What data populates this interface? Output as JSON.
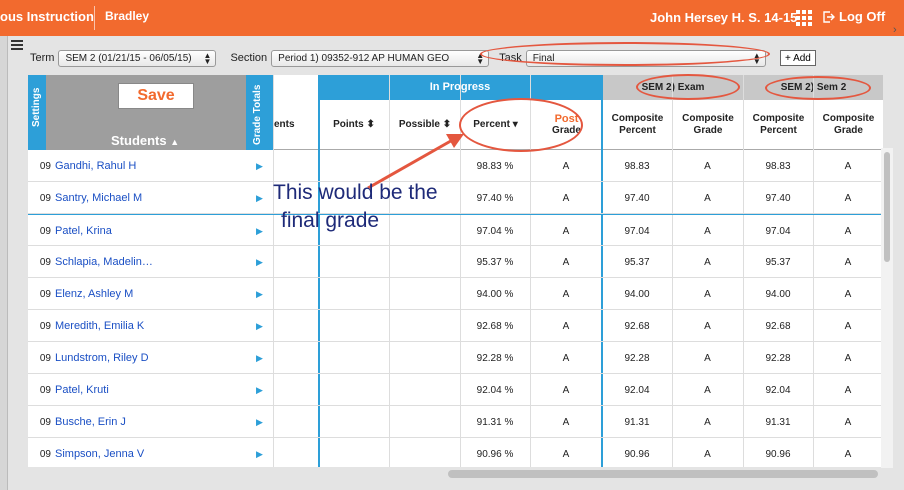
{
  "topbar": {
    "app_title": "ous Instruction",
    "user": "Bradley",
    "school": "John Hersey H. S. 14-15",
    "logoff": "Log Off"
  },
  "filters": {
    "term_label": "Term",
    "term_value": "SEM 2 (01/21/15 - 06/05/15)",
    "section_label": "Section",
    "section_value": "Period 1) 09352-912 AP HUMAN GEO",
    "task_label": "Task",
    "task_value": "Final",
    "add_label": "+ Add"
  },
  "grid": {
    "settings_label": "Settings",
    "save_label": "Save",
    "students_label": "Students",
    "grade_totals_label": "Grade Totals",
    "in_progress_label": "In Progress",
    "exam_label": "SEM 2) Exam",
    "sem2_label": "SEM 2) Sem 2",
    "columns": {
      "ents": "ents",
      "points": "Points",
      "possible": "Possible",
      "percent": "Percent",
      "post": "Post",
      "grade": "Grade",
      "composite_percent": "Composite Percent",
      "composite_grade": "Composite Grade"
    },
    "rows": [
      {
        "grade": "09",
        "name": "Gandhi, Rahul H",
        "percent": "98.83 %",
        "post_grade": "A",
        "exam_pct": "98.83",
        "exam_grade": "A",
        "sem_pct": "98.83",
        "sem_grade": "A"
      },
      {
        "grade": "09",
        "name": "Santry, Michael M",
        "percent": "97.40 %",
        "post_grade": "A",
        "exam_pct": "97.40",
        "exam_grade": "A",
        "sem_pct": "97.40",
        "sem_grade": "A"
      },
      {
        "grade": "09",
        "name": "Patel, Krina",
        "percent": "97.04 %",
        "post_grade": "A",
        "exam_pct": "97.04",
        "exam_grade": "A",
        "sem_pct": "97.04",
        "sem_grade": "A"
      },
      {
        "grade": "09",
        "name": "Schlapia, Madelin…",
        "percent": "95.37 %",
        "post_grade": "A",
        "exam_pct": "95.37",
        "exam_grade": "A",
        "sem_pct": "95.37",
        "sem_grade": "A"
      },
      {
        "grade": "09",
        "name": "Elenz, Ashley M",
        "percent": "94.00 %",
        "post_grade": "A",
        "exam_pct": "94.00",
        "exam_grade": "A",
        "sem_pct": "94.00",
        "sem_grade": "A"
      },
      {
        "grade": "09",
        "name": "Meredith, Emilia K",
        "percent": "92.68 %",
        "post_grade": "A",
        "exam_pct": "92.68",
        "exam_grade": "A",
        "sem_pct": "92.68",
        "sem_grade": "A"
      },
      {
        "grade": "09",
        "name": "Lundstrom, Riley D",
        "percent": "92.28 %",
        "post_grade": "A",
        "exam_pct": "92.28",
        "exam_grade": "A",
        "sem_pct": "92.28",
        "sem_grade": "A"
      },
      {
        "grade": "09",
        "name": "Patel, Kruti",
        "percent": "92.04 %",
        "post_grade": "A",
        "exam_pct": "92.04",
        "exam_grade": "A",
        "sem_pct": "92.04",
        "sem_grade": "A"
      },
      {
        "grade": "09",
        "name": "Busche, Erin J",
        "percent": "91.31 %",
        "post_grade": "A",
        "exam_pct": "91.31",
        "exam_grade": "A",
        "sem_pct": "91.31",
        "sem_grade": "A"
      },
      {
        "grade": "09",
        "name": "Simpson, Jenna V",
        "percent": "90.96 %",
        "post_grade": "A",
        "exam_pct": "90.96",
        "exam_grade": "A",
        "sem_pct": "90.96",
        "sem_grade": "A"
      }
    ]
  },
  "annotation": {
    "line1": "This would be the",
    "line2": "final grade"
  },
  "colors": {
    "brand": "#f26a2e",
    "accent": "#2d9fd8",
    "annotation_red": "#e4573f",
    "annotation_text": "#1e2a78",
    "link": "#1a4fc4"
  }
}
